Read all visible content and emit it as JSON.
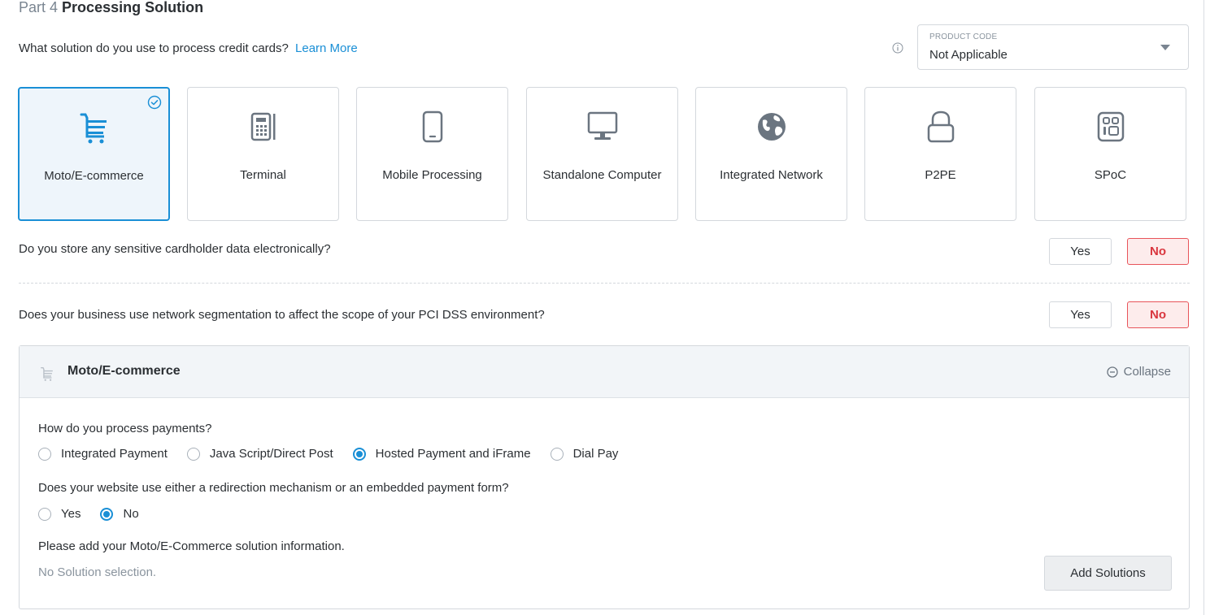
{
  "header": {
    "part_prefix": "Part 4",
    "part_title": "Processing Solution"
  },
  "question_solution": {
    "text": "What solution do you use to process credit cards?",
    "learn_more": "Learn More"
  },
  "product_code": {
    "label": "PRODUCT CODE",
    "value": "Not Applicable"
  },
  "solutions": [
    {
      "label": "Moto/E-commerce",
      "icon": "shopping-cart-icon",
      "selected": true
    },
    {
      "label": "Terminal",
      "icon": "terminal-icon",
      "selected": false
    },
    {
      "label": "Mobile Processing",
      "icon": "mobile-phone-icon",
      "selected": false
    },
    {
      "label": "Standalone Computer",
      "icon": "monitor-icon",
      "selected": false
    },
    {
      "label": "Integrated Network",
      "icon": "globe-icon",
      "selected": false
    },
    {
      "label": "P2PE",
      "icon": "lock-icon",
      "selected": false
    },
    {
      "label": "SPoC",
      "icon": "pin-pad-icon",
      "selected": false
    }
  ],
  "q_store": {
    "text": "Do you store any sensitive cardholder data electronically?",
    "yes": "Yes",
    "no": "No",
    "selected": "No"
  },
  "q_segmentation": {
    "text": "Does your business use network segmentation to affect the scope of your PCI DSS environment?",
    "yes": "Yes",
    "no": "No",
    "selected": "No"
  },
  "panel": {
    "title": "Moto/E-commerce",
    "collapse": "Collapse",
    "q_payments": "How do you process payments?",
    "payment_options": [
      {
        "label": "Integrated Payment",
        "selected": false
      },
      {
        "label": "Java Script/Direct Post",
        "selected": false
      },
      {
        "label": "Hosted Payment and iFrame",
        "selected": true
      },
      {
        "label": "Dial Pay",
        "selected": false
      }
    ],
    "q_redirect": "Does your website use either a redirection mechanism or an embedded payment form?",
    "redirect_options": [
      {
        "label": "Yes",
        "selected": false
      },
      {
        "label": "No",
        "selected": true
      }
    ],
    "q_add": "Please add your Moto/E-Commerce solution information.",
    "no_solution": "No Solution selection.",
    "add_button": "Add Solutions"
  },
  "colors": {
    "accent": "#1a8fd6",
    "danger": "#d9363e",
    "icon_gray": "#6b7580"
  }
}
